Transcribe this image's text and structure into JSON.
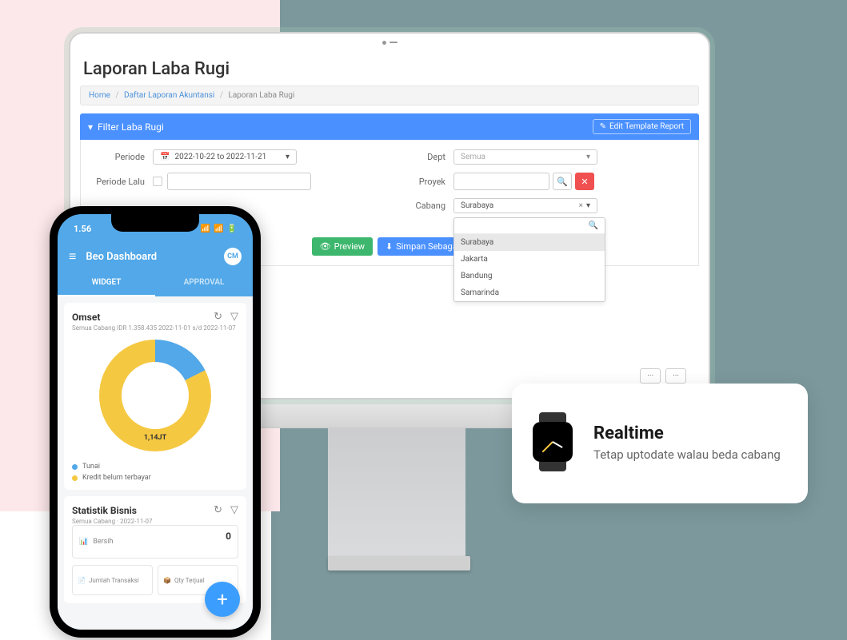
{
  "desktop": {
    "page_title": "Laporan Laba Rugi",
    "breadcrumb": {
      "home": "Home",
      "list": "Daftar Laporan Akuntansi",
      "current": "Laporan Laba Rugi"
    },
    "filter": {
      "title": "Filter Laba Rugi",
      "edit_template": "Edit Template Report",
      "periode_label": "Periode",
      "periode_value": "2022-10-22 to 2022-11-21",
      "periode_lalu_label": "Periode Lalu",
      "dept_label": "Dept",
      "dept_placeholder": "Semua",
      "proyek_label": "Proyek",
      "cabang_label": "Cabang",
      "cabang_value": "Surabaya",
      "cabang_options": [
        "Surabaya",
        "Jakarta",
        "Bandung",
        "Samarinda"
      ]
    },
    "actions": {
      "preview": "Preview",
      "simpan": "Simpan Sebagai"
    }
  },
  "phone": {
    "time": "1.56",
    "app_title": "Beo Dashboard",
    "avatar": "CM",
    "tabs": {
      "widget": "WIDGET",
      "approval": "APPROVAL"
    },
    "omset": {
      "title": "Omset",
      "subtitle": "Semua Cabang IDR 1.358.435 2022-11-01 s/d 2022-11-07",
      "center_label": "1,14JT",
      "legend_tunai": "Tunai",
      "legend_kredit": "Kredit belum terbayar"
    },
    "statistik": {
      "title": "Statistik Bisnis",
      "subtitle": "Semua Cabang · 2022-11-07",
      "box_bersih": "Bersih",
      "box_bersih_val": "0",
      "box_jumlah": "Jumlah Transaksi",
      "box_qty": "Qty Terjual"
    }
  },
  "realtime": {
    "title": "Realtime",
    "desc": "Tetap uptodate walau beda cabang"
  },
  "colors": {
    "blue": "#52a8e8",
    "yellow": "#f5c842"
  }
}
